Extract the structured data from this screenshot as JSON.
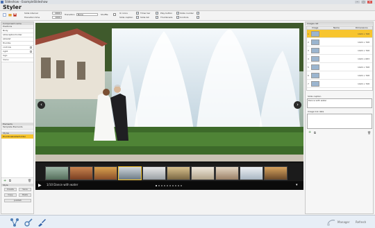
{
  "window": {
    "title": "Slideshow - ExampleSlideshow"
  },
  "header": {
    "title": "Styler"
  },
  "toolbar": {
    "slide_interval_label": "Slide interval",
    "slide_interval_value": "2000",
    "transition_time_label": "Transition time",
    "transition_time_value": "1000",
    "transition_label": "Transition",
    "transition_value": "None",
    "shuffle_label": "Shuffle",
    "col1": [
      "Ui icons",
      "Slide caption"
    ],
    "col2": [
      "Timer bar",
      "Slide list"
    ],
    "col3": [
      "Play button",
      "Thumbnails"
    ],
    "col4": [
      "Slide counter",
      "Controls"
    ]
  },
  "left_panel": {
    "section1_title": "Component name",
    "section1_sub": "Positions",
    "items": [
      "Body",
      "slidecaptionholder",
      "slidelist",
      "thumbs",
      "controls",
      "right",
      "logo",
      "menu"
    ],
    "section2_title": "Elements",
    "section2_sub": "Template Elements",
    "section3_title": "Styles",
    "selected_item": "thumbnailsliderholder",
    "buttons_title": "Style",
    "btn_create": "Create",
    "btn_save": "Save",
    "btn_copy": "Copy",
    "btn_paste": "Paste",
    "btn_publish": "publish"
  },
  "viewer": {
    "caption": "1/10 Dance with water",
    "prev_glyph": "‹",
    "next_glyph": "›",
    "play_glyph": "▶",
    "menu_glyph": "▾"
  },
  "right_panel": {
    "title": "Images list",
    "col_image": "Image",
    "col_name": "Name",
    "col_dimensions": "Dimensions",
    "rows": [
      {
        "num": "1",
        "dim": "1024 x 768",
        "selected": true
      },
      {
        "num": "2",
        "dim": "1024 x 768",
        "selected": false
      },
      {
        "num": "3",
        "dim": "1024 x 768",
        "selected": false
      },
      {
        "num": "4",
        "dim": "1024 x 683",
        "selected": false
      },
      {
        "num": "5",
        "dim": "1024 x 768",
        "selected": false
      },
      {
        "num": "6",
        "dim": "1024 x 768",
        "selected": false
      },
      {
        "num": "7",
        "dim": "1024 x 768",
        "selected": false
      }
    ],
    "caption_label": "Slide caption",
    "caption_value": "Dance with water",
    "link_label": "Image link data",
    "link_value": ""
  },
  "bottom": {
    "manager_label": "Manager",
    "refresh_label": "Refresh"
  }
}
